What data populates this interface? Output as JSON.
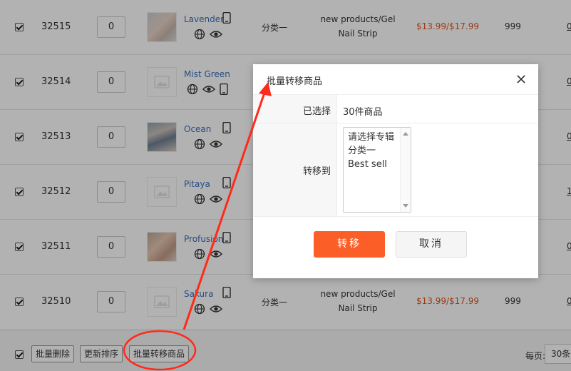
{
  "rows": [
    {
      "id": "32515",
      "sort": "0",
      "name": "Lavender",
      "category": "分类一",
      "collection_line1": "new products/Gel",
      "collection_line2": "Nail Strip",
      "price": "$13.99/$17.99",
      "stock": "999",
      "edge": "0"
    },
    {
      "id": "32514",
      "sort": "0",
      "name": "Mist Green",
      "category": "",
      "collection_line1": "",
      "collection_line2": "",
      "price": "",
      "stock": "",
      "edge": "0"
    },
    {
      "id": "32513",
      "sort": "0",
      "name": "Ocean",
      "category": "",
      "collection_line1": "",
      "collection_line2": "",
      "price": "",
      "stock": "",
      "edge": "0"
    },
    {
      "id": "32512",
      "sort": "0",
      "name": "Pitaya",
      "category": "",
      "collection_line1": "",
      "collection_line2": "",
      "price": "",
      "stock": "",
      "edge": "1"
    },
    {
      "id": "32511",
      "sort": "0",
      "name": "Profusion",
      "category": "",
      "collection_line1": "",
      "collection_line2": "",
      "price": "",
      "stock": "",
      "edge": "0"
    },
    {
      "id": "32510",
      "sort": "0",
      "name": "Sakura",
      "category": "分类一",
      "collection_line1": "new products/Gel",
      "collection_line2": "Nail Strip",
      "price": "$13.99/$17.99",
      "stock": "999",
      "edge": "0"
    }
  ],
  "footer": {
    "bulk_delete": "批量删除",
    "update_sort": "更新排序",
    "bulk_move": "批量转移商品",
    "per_page_label": "每页:",
    "per_page_value": "30条"
  },
  "modal": {
    "title": "批量转移商品",
    "selected_label": "已选择",
    "selected_value": "30件商品",
    "move_to_label": "转移到",
    "options": [
      "请选择专辑",
      "分类一",
      "Best sell"
    ],
    "confirm": "转移",
    "cancel": "取消"
  },
  "colors": {
    "accent": "#fb5f27",
    "price": "#e0541a",
    "link": "#3a6fb8",
    "annotation": "#ff2a1a"
  }
}
